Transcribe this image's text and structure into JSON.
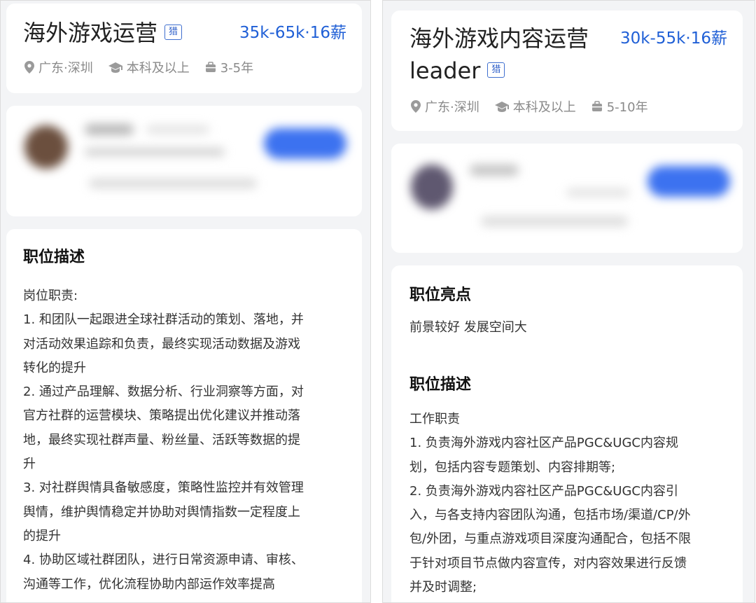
{
  "left": {
    "title": "海外游戏运营",
    "tag": "猎",
    "salary": "35k-65k·16薪",
    "meta": {
      "location": "广东·深圳",
      "education": "本科及以上",
      "experience": "3-5年"
    },
    "section_title": "职位描述",
    "body_lines": [
      "岗位职责:",
      "1. 和团队一起跟进全球社群活动的策划、落地，并",
      "对活动效果追踪和负责，最终实现活动数据及游戏",
      "转化的提升",
      "2. 通过产品理解、数据分析、行业洞察等方面，对",
      "官方社群的运营模块、策略提出优化建议并推动落",
      "地，最终实现社群声量、粉丝量、活跃等数据的提",
      "升",
      "3. 对社群舆情具备敏感度，策略性监控并有效管理",
      "舆情，维护舆情稳定并协助对舆情指数一定程度上",
      "的提升",
      "4. 协助区域社群团队，进行日常资源申请、审核、",
      "沟通等工作，优化流程协助内部运作效率提高"
    ]
  },
  "right": {
    "title_line1": "海外游戏内容运营",
    "title_line2": "leader",
    "tag": "猎",
    "salary": "30k-55k·16薪",
    "meta": {
      "location": "广东·深圳",
      "education": "本科及以上",
      "experience": "5-10年"
    },
    "highlights_title": "职位亮点",
    "highlights_text": "前景较好 发展空间大",
    "section_title": "职位描述",
    "body_lines": [
      "工作职责",
      "1. 负责海外游戏内容社区产品PGC&UGC内容规",
      "划，包括内容专题策划、内容排期等;",
      "2. 负责海外游戏内容社区产品PGC&UGC内容引",
      "入，与各支持内容团队沟通，包括市场/渠道/CP/外",
      "包/外团，与重点游戏项目深度沟通配合，包括不限",
      "于针对项目节点做内容宣传，对内容效果进行反馈",
      "并及时调整;"
    ]
  },
  "colors": {
    "salary": "#1f5fd6",
    "tag_border": "#3f6fcf",
    "meta_text": "#8a8a8a",
    "background": "#f3f4f6"
  },
  "icons": [
    "location-pin-icon",
    "graduation-cap-icon",
    "briefcase-icon"
  ]
}
